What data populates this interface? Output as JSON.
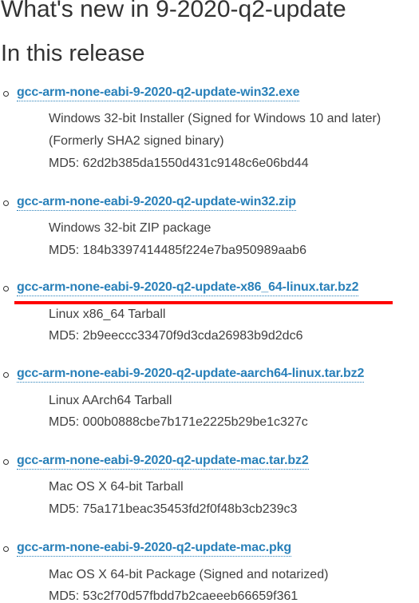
{
  "page": {
    "title": "What's new in 9-2020-q2-update",
    "section_title": "In this release"
  },
  "releases": [
    {
      "filename": "gcc-arm-none-eabi-9-2020-q2-update-win32.exe",
      "description_lines": [
        "Windows 32-bit Installer (Signed for Windows 10 and later)",
        "(Formerly SHA2 signed binary)"
      ],
      "md5": "MD5: 62d2b385da1550d431c9148c6e06bd44"
    },
    {
      "filename": "gcc-arm-none-eabi-9-2020-q2-update-win32.zip",
      "description_lines": [
        "Windows 32-bit ZIP package"
      ],
      "md5": "MD5: 184b3397414485f224e7ba950989aab6"
    },
    {
      "filename": "gcc-arm-none-eabi-9-2020-q2-update-x86_64-linux.tar.bz2",
      "description_lines": [
        "Linux x86_64 Tarball"
      ],
      "md5": "MD5: 2b9eeccc33470f9d3cda26983b9d2dc6",
      "highlighted": true
    },
    {
      "filename": "gcc-arm-none-eabi-9-2020-q2-update-aarch64-linux.tar.bz2",
      "description_lines": [
        "Linux AArch64 Tarball"
      ],
      "md5": "MD5: 000b0888cbe7b171e2225b29be1c327c"
    },
    {
      "filename": "gcc-arm-none-eabi-9-2020-q2-update-mac.tar.bz2",
      "description_lines": [
        "Mac OS X 64-bit Tarball"
      ],
      "md5": "MD5: 75a171beac35453fd2f0f48b3cb239c3"
    },
    {
      "filename": "gcc-arm-none-eabi-9-2020-q2-update-mac.pkg",
      "description_lines": [
        "Mac OS X 64-bit Package (Signed and notarized)"
      ],
      "md5": "MD5: 53c2f70d57fbdd7b2caeeeb66659f361"
    }
  ],
  "colors": {
    "link": "#2980b9",
    "text": "#404040",
    "heading": "#333333",
    "highlight_underline": "#ff0000"
  }
}
